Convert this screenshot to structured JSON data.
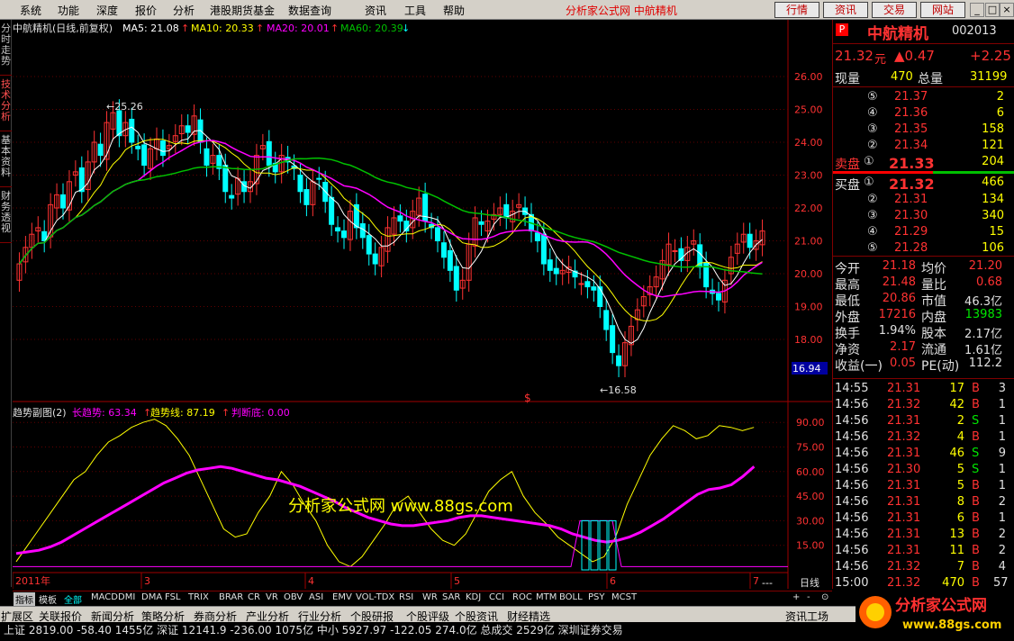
{
  "menu": [
    "系统",
    "功能",
    "深度",
    "报价",
    "分析",
    "港股期货基金",
    "数据查询",
    "资讯",
    "工具",
    "帮助"
  ],
  "brand": "分析家公式网  中航精机",
  "top_buttons": [
    "行情",
    "资讯",
    "交易",
    "网站"
  ],
  "left_tabs": [
    "分时走势",
    "技术分析",
    "基本资料",
    "财务透视"
  ],
  "main_legend": {
    "title": "中航精机(日线,前复权)",
    "ma5": "MA5: 21.08",
    "ma10": "MA10: 20.33",
    "ma20": "MA20: 20.01",
    "ma60": "MA60: 20.39"
  },
  "price_axis": [
    "26.00",
    "25.00",
    "24.00",
    "23.00",
    "22.00",
    "21.00",
    "20.00",
    "19.00",
    "18.00",
    "16.94"
  ],
  "high_label": "25.26",
  "low_label": "16.58",
  "sub_legend": {
    "title": "趋势副图(2)",
    "long": "长趋势: 63.34",
    "line": "趋势线: 87.19",
    "judge": "判断底: 0.00"
  },
  "sub_axis": [
    "90.00",
    "75.00",
    "60.00",
    "45.00",
    "30.00",
    "15.00"
  ],
  "watermark": "分析家公式网  www.88gs.com",
  "x_axis": [
    "2011年",
    "3",
    "4",
    "5",
    "6",
    "7"
  ],
  "period": "日线",
  "colors": {
    "ma5": "#ffffff",
    "ma10": "#ffff00",
    "ma20": "#ff00ff",
    "ma60": "#00c000",
    "up": "#ff3232",
    "down": "#00ffff"
  },
  "stock": {
    "flag": "P",
    "name": "中航精机",
    "code": "002013",
    "price": "21.32",
    "unit": "元",
    "change": "0.47",
    "pct": "+2.25",
    "vol_label": "现量",
    "vol": "470",
    "total_label": "总量",
    "total": "31199"
  },
  "sells": [
    [
      "⑤",
      "21.37",
      "2"
    ],
    [
      "④",
      "21.36",
      "6"
    ],
    [
      "③",
      "21.35",
      "158"
    ],
    [
      "②",
      "21.34",
      "121"
    ]
  ],
  "sell1": {
    "label": "卖盘",
    "num": "①",
    "price": "21.33",
    "qty": "204"
  },
  "buy1": {
    "label": "买盘",
    "num": "①",
    "price": "21.32",
    "qty": "466"
  },
  "buys": [
    [
      "②",
      "21.31",
      "134"
    ],
    [
      "③",
      "21.30",
      "340"
    ],
    [
      "④",
      "21.29",
      "15"
    ],
    [
      "⑤",
      "21.28",
      "106"
    ]
  ],
  "stats": [
    [
      "今开",
      "21.18",
      "均价",
      "21.20"
    ],
    [
      "最高",
      "21.48",
      "量比",
      "0.68"
    ],
    [
      "最低",
      "20.86",
      "市值",
      "46.3亿"
    ],
    [
      "外盘",
      "17216",
      "内盘",
      "13983"
    ],
    [
      "换手",
      "1.94%",
      "股本",
      "2.17亿"
    ],
    [
      "净资",
      "2.17",
      "流通",
      "1.61亿"
    ],
    [
      "收益(一)",
      "0.05",
      "PE(动)",
      "112.2"
    ]
  ],
  "ticks": [
    [
      "14:55",
      "21.31",
      "17",
      "B",
      "3"
    ],
    [
      "14:56",
      "21.32",
      "42",
      "B",
      "1"
    ],
    [
      "14:56",
      "21.31",
      "2",
      "S",
      "1"
    ],
    [
      "14:56",
      "21.32",
      "4",
      "B",
      "1"
    ],
    [
      "14:56",
      "21.31",
      "46",
      "S",
      "9"
    ],
    [
      "14:56",
      "21.30",
      "5",
      "S",
      "1"
    ],
    [
      "14:56",
      "21.31",
      "5",
      "B",
      "1"
    ],
    [
      "14:56",
      "21.31",
      "8",
      "B",
      "2"
    ],
    [
      "14:56",
      "21.31",
      "6",
      "B",
      "1"
    ],
    [
      "14:56",
      "21.31",
      "13",
      "B",
      "2"
    ],
    [
      "14:56",
      "21.31",
      "11",
      "B",
      "2"
    ],
    [
      "14:56",
      "21.32",
      "7",
      "B",
      "4"
    ],
    [
      "15:00",
      "21.32",
      "470",
      "B",
      "57"
    ]
  ],
  "ind_tabs": [
    "指标",
    "模板",
    "全部",
    "MACD",
    "DMI",
    "DMA",
    "FSL",
    "TRIX",
    "BRAR",
    "CR",
    "VR",
    "OBV",
    "ASI",
    "EMV",
    "VOL-TDX",
    "RSI",
    "WR",
    "SAR",
    "KDJ",
    "CCI",
    "ROC",
    "MTM",
    "BOLL",
    "PSY",
    "MCST"
  ],
  "bottom_tabs": [
    "扩展区",
    "关联报价",
    "新闻分析",
    "策略分析",
    "券商分析",
    "产业分析",
    "行业分析",
    "个股研报",
    "个股评级",
    "个股资讯",
    "财经精选"
  ],
  "right_bottom": "资讯工场",
  "ticker": "上证 2819.00  -58.40  1455亿  深证 12141.9  -236.00  1075亿  中小 5927.97  -122.05  274.0亿  总成交 2529亿  深圳证券交易",
  "logo": {
    "title": "分析家公式网",
    "url": "www.88gs.com"
  }
}
